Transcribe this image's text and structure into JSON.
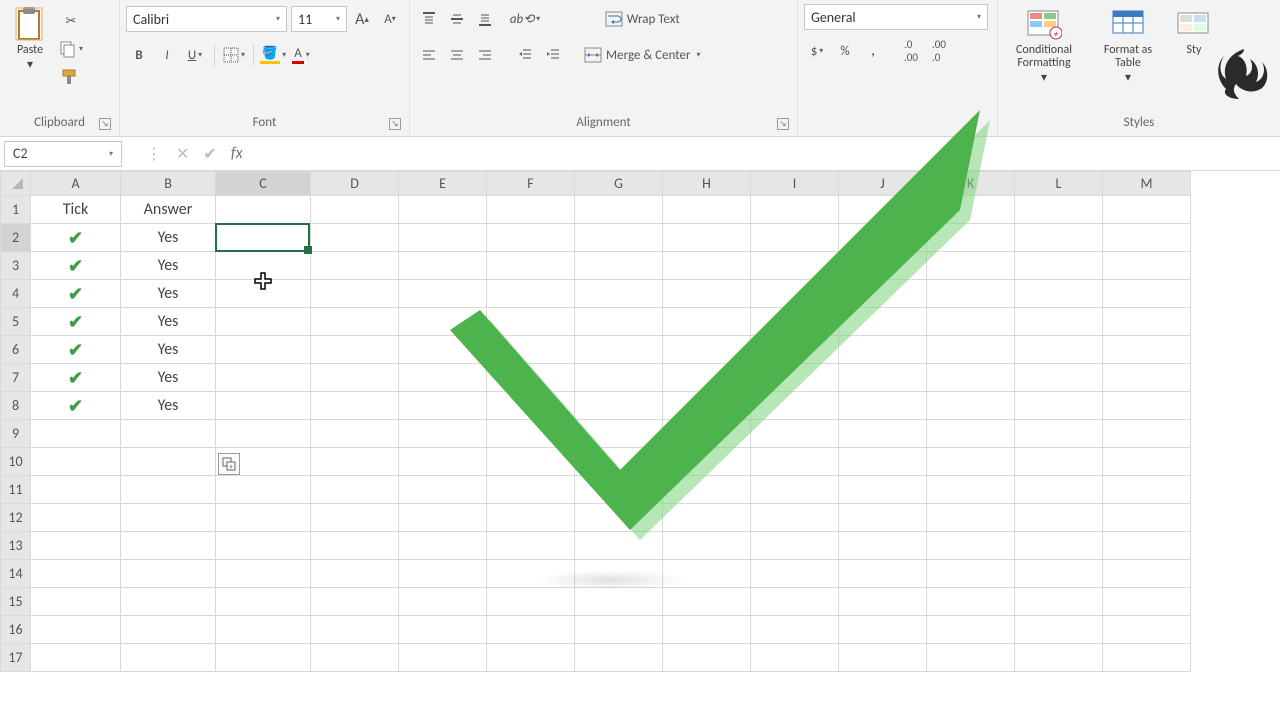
{
  "ribbon": {
    "clipboard": {
      "label": "Clipboard",
      "paste": "Paste"
    },
    "font": {
      "label": "Font",
      "name": "Calibri",
      "size": "11",
      "bold": "B",
      "italic": "I",
      "underline": "U"
    },
    "alignment": {
      "label": "Alignment",
      "wrap": "Wrap Text",
      "merge": "Merge & Center"
    },
    "number": {
      "label": "",
      "format": "General",
      "currency": "$",
      "percent": "%",
      "comma": ","
    },
    "styles": {
      "label": "Styles",
      "conditional": "Conditional\nFormatting",
      "table": "Format as\nTable",
      "cellstyles": "Sty"
    }
  },
  "formula_bar": {
    "cell_ref": "C2",
    "fx": "fx",
    "value": ""
  },
  "grid": {
    "columns": [
      "A",
      "B",
      "C",
      "D",
      "E",
      "F",
      "G",
      "H",
      "I",
      "J",
      "K",
      "L",
      "M"
    ],
    "rows": [
      "1",
      "2",
      "3",
      "4",
      "5",
      "6",
      "7",
      "8",
      "9",
      "10",
      "11",
      "12",
      "13",
      "14",
      "15",
      "16",
      "17"
    ],
    "headers": {
      "A": "Tick",
      "B": "Answer"
    },
    "data": [
      {
        "tick": "✔",
        "answer": "Yes"
      },
      {
        "tick": "✔",
        "answer": "Yes"
      },
      {
        "tick": "✔",
        "answer": "Yes"
      },
      {
        "tick": "✔",
        "answer": "Yes"
      },
      {
        "tick": "✔",
        "answer": "Yes"
      },
      {
        "tick": "✔",
        "answer": "Yes"
      },
      {
        "tick": "✔",
        "answer": "Yes"
      }
    ],
    "selected_cell": "C2"
  }
}
